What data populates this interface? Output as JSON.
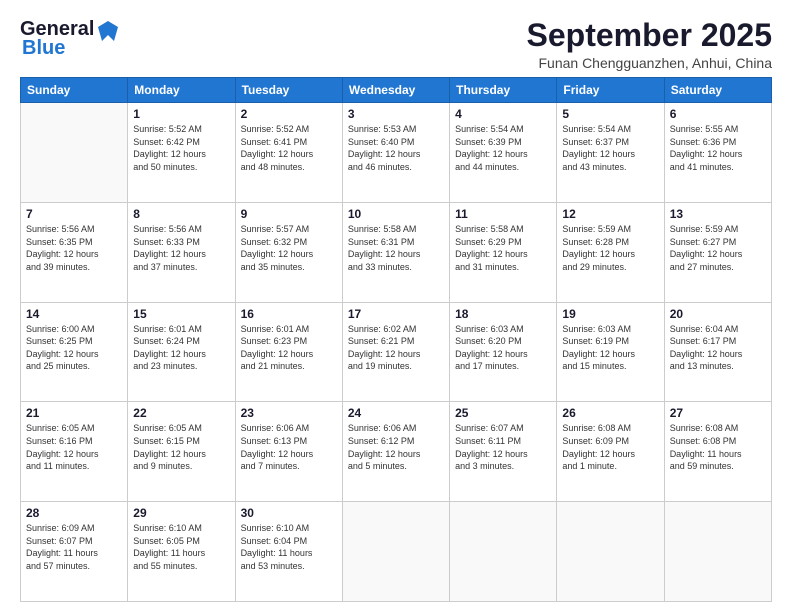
{
  "logo": {
    "line1": "General",
    "line2": "Blue"
  },
  "title": "September 2025",
  "subtitle": "Funan Chengguanzhen, Anhui, China",
  "weekdays": [
    "Sunday",
    "Monday",
    "Tuesday",
    "Wednesday",
    "Thursday",
    "Friday",
    "Saturday"
  ],
  "weeks": [
    [
      {
        "day": "",
        "info": ""
      },
      {
        "day": "1",
        "info": "Sunrise: 5:52 AM\nSunset: 6:42 PM\nDaylight: 12 hours\nand 50 minutes."
      },
      {
        "day": "2",
        "info": "Sunrise: 5:52 AM\nSunset: 6:41 PM\nDaylight: 12 hours\nand 48 minutes."
      },
      {
        "day": "3",
        "info": "Sunrise: 5:53 AM\nSunset: 6:40 PM\nDaylight: 12 hours\nand 46 minutes."
      },
      {
        "day": "4",
        "info": "Sunrise: 5:54 AM\nSunset: 6:39 PM\nDaylight: 12 hours\nand 44 minutes."
      },
      {
        "day": "5",
        "info": "Sunrise: 5:54 AM\nSunset: 6:37 PM\nDaylight: 12 hours\nand 43 minutes."
      },
      {
        "day": "6",
        "info": "Sunrise: 5:55 AM\nSunset: 6:36 PM\nDaylight: 12 hours\nand 41 minutes."
      }
    ],
    [
      {
        "day": "7",
        "info": "Sunrise: 5:56 AM\nSunset: 6:35 PM\nDaylight: 12 hours\nand 39 minutes."
      },
      {
        "day": "8",
        "info": "Sunrise: 5:56 AM\nSunset: 6:33 PM\nDaylight: 12 hours\nand 37 minutes."
      },
      {
        "day": "9",
        "info": "Sunrise: 5:57 AM\nSunset: 6:32 PM\nDaylight: 12 hours\nand 35 minutes."
      },
      {
        "day": "10",
        "info": "Sunrise: 5:58 AM\nSunset: 6:31 PM\nDaylight: 12 hours\nand 33 minutes."
      },
      {
        "day": "11",
        "info": "Sunrise: 5:58 AM\nSunset: 6:29 PM\nDaylight: 12 hours\nand 31 minutes."
      },
      {
        "day": "12",
        "info": "Sunrise: 5:59 AM\nSunset: 6:28 PM\nDaylight: 12 hours\nand 29 minutes."
      },
      {
        "day": "13",
        "info": "Sunrise: 5:59 AM\nSunset: 6:27 PM\nDaylight: 12 hours\nand 27 minutes."
      }
    ],
    [
      {
        "day": "14",
        "info": "Sunrise: 6:00 AM\nSunset: 6:25 PM\nDaylight: 12 hours\nand 25 minutes."
      },
      {
        "day": "15",
        "info": "Sunrise: 6:01 AM\nSunset: 6:24 PM\nDaylight: 12 hours\nand 23 minutes."
      },
      {
        "day": "16",
        "info": "Sunrise: 6:01 AM\nSunset: 6:23 PM\nDaylight: 12 hours\nand 21 minutes."
      },
      {
        "day": "17",
        "info": "Sunrise: 6:02 AM\nSunset: 6:21 PM\nDaylight: 12 hours\nand 19 minutes."
      },
      {
        "day": "18",
        "info": "Sunrise: 6:03 AM\nSunset: 6:20 PM\nDaylight: 12 hours\nand 17 minutes."
      },
      {
        "day": "19",
        "info": "Sunrise: 6:03 AM\nSunset: 6:19 PM\nDaylight: 12 hours\nand 15 minutes."
      },
      {
        "day": "20",
        "info": "Sunrise: 6:04 AM\nSunset: 6:17 PM\nDaylight: 12 hours\nand 13 minutes."
      }
    ],
    [
      {
        "day": "21",
        "info": "Sunrise: 6:05 AM\nSunset: 6:16 PM\nDaylight: 12 hours\nand 11 minutes."
      },
      {
        "day": "22",
        "info": "Sunrise: 6:05 AM\nSunset: 6:15 PM\nDaylight: 12 hours\nand 9 minutes."
      },
      {
        "day": "23",
        "info": "Sunrise: 6:06 AM\nSunset: 6:13 PM\nDaylight: 12 hours\nand 7 minutes."
      },
      {
        "day": "24",
        "info": "Sunrise: 6:06 AM\nSunset: 6:12 PM\nDaylight: 12 hours\nand 5 minutes."
      },
      {
        "day": "25",
        "info": "Sunrise: 6:07 AM\nSunset: 6:11 PM\nDaylight: 12 hours\nand 3 minutes."
      },
      {
        "day": "26",
        "info": "Sunrise: 6:08 AM\nSunset: 6:09 PM\nDaylight: 12 hours\nand 1 minute."
      },
      {
        "day": "27",
        "info": "Sunrise: 6:08 AM\nSunset: 6:08 PM\nDaylight: 11 hours\nand 59 minutes."
      }
    ],
    [
      {
        "day": "28",
        "info": "Sunrise: 6:09 AM\nSunset: 6:07 PM\nDaylight: 11 hours\nand 57 minutes."
      },
      {
        "day": "29",
        "info": "Sunrise: 6:10 AM\nSunset: 6:05 PM\nDaylight: 11 hours\nand 55 minutes."
      },
      {
        "day": "30",
        "info": "Sunrise: 6:10 AM\nSunset: 6:04 PM\nDaylight: 11 hours\nand 53 minutes."
      },
      {
        "day": "",
        "info": ""
      },
      {
        "day": "",
        "info": ""
      },
      {
        "day": "",
        "info": ""
      },
      {
        "day": "",
        "info": ""
      }
    ]
  ]
}
